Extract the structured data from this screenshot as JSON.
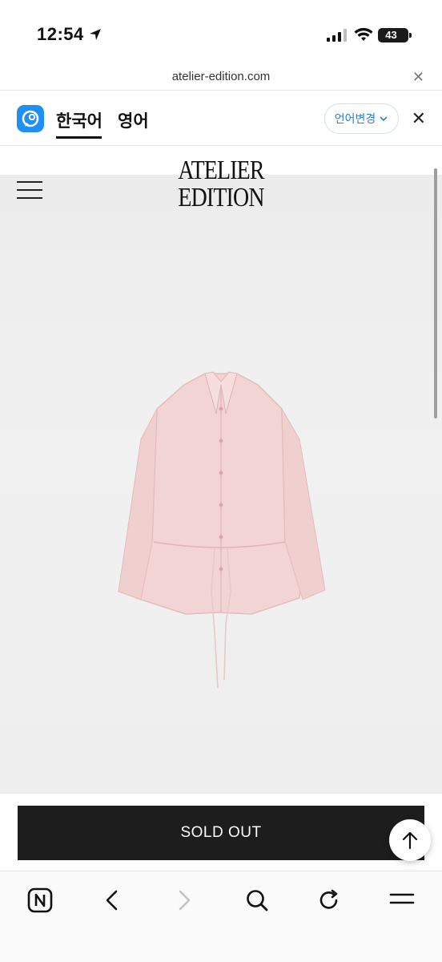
{
  "status_bar": {
    "time": "12:54",
    "battery": "43",
    "icons": [
      "location-arrow-icon",
      "signal-icon",
      "wifi-icon",
      "battery-icon"
    ]
  },
  "browser": {
    "url": "atelier-edition.com"
  },
  "translate_bar": {
    "source_lang": "한국어",
    "target_lang": "영어",
    "change_label": "언어변경",
    "accent_color": "#1f8ff3"
  },
  "site": {
    "logo_line1": "ATELIER",
    "logo_line2": "EDITION"
  },
  "product": {
    "button_label": "SOLD OUT",
    "button_color": "#1d1d1d",
    "garment_color": "#f2d4d4"
  },
  "toolbar": {
    "icons": [
      "naver-home-icon",
      "back-icon",
      "forward-icon",
      "search-icon",
      "reload-icon",
      "menu-icon"
    ]
  }
}
